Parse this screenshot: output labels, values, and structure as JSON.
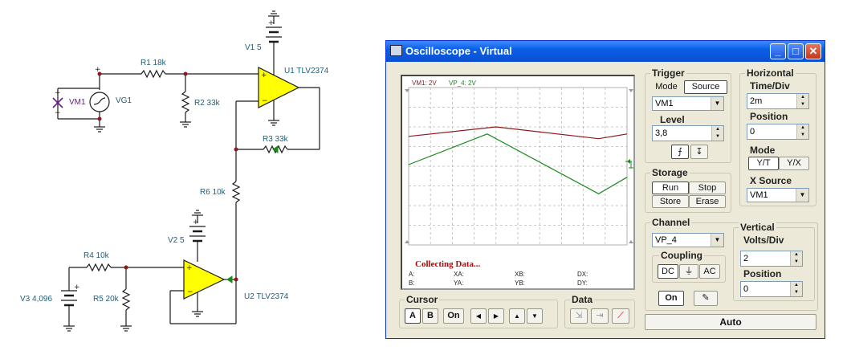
{
  "schematic": {
    "labels": {
      "vm1": "VM1",
      "vg1": "VG1",
      "r1": "R1 18k",
      "r2": "R2 33k",
      "v1": "V1 5",
      "u1": "U1 TLV2374",
      "r3": "R3 33k",
      "r6": "R6 10k",
      "v2": "V2 5",
      "r4": "R4 10k",
      "r5": "R5 20k",
      "v3": "V3 4,096",
      "u2": "U2 TLV2374"
    }
  },
  "window": {
    "title": "Oscilloscope - Virtual",
    "controls": {
      "minimize": "_",
      "maximize": "□",
      "close": "✕"
    }
  },
  "screen": {
    "ch1_label": "VM1: 2V",
    "ch2_label": "VP_4: 2V",
    "ch1_color": "#8b1a1a",
    "ch2_color": "#1a8a1a",
    "collecting": "Collecting Data...",
    "readouts": {
      "a": "A:",
      "xa": "XA:",
      "xb": "XB:",
      "dx": "DX:",
      "b": "B:",
      "ya": "YA:",
      "yb": "YB:",
      "dy": "DY:"
    }
  },
  "chart_data": {
    "type": "line",
    "x": [
      0,
      0.2,
      0.4,
      0.6,
      0.8,
      1.0
    ],
    "series": [
      {
        "name": "VM1",
        "x": [
          0,
          0.4,
          0.87,
          1.0
        ],
        "y": [
          1.9,
          2.5,
          1.75,
          2.05
        ]
      },
      {
        "name": "VP_4",
        "x": [
          0,
          0.36,
          0.87,
          1.0
        ],
        "y": [
          0.1,
          2.05,
          -1.75,
          -0.7
        ]
      }
    ],
    "xlim": [
      0,
      1
    ],
    "ylim": [
      -5,
      5
    ],
    "grid": true
  },
  "trigger": {
    "title": "Trigger",
    "mode": "Mode",
    "source": "Source",
    "source_value": "VM1",
    "level_label": "Level",
    "level_value": "3,8"
  },
  "horizontal": {
    "title": "Horizontal",
    "timediv_label": "Time/Div",
    "timediv_value": "2m",
    "position_label": "Position",
    "position_value": "0",
    "mode_label": "Mode",
    "yt": "Y/T",
    "yx": "Y/X",
    "xsource_label": "X Source",
    "xsource_value": "VM1"
  },
  "storage": {
    "title": "Storage",
    "run": "Run",
    "stop": "Stop",
    "store": "Store",
    "erase": "Erase"
  },
  "channel": {
    "title": "Channel",
    "value": "VP_4",
    "coupling_title": "Coupling",
    "dc": "DC",
    "ac": "AC",
    "on": "On"
  },
  "vertical": {
    "title": "Vertical",
    "voltsdiv_label": "Volts/Div",
    "voltsdiv_value": "2",
    "position_label": "Position",
    "position_value": "0"
  },
  "cursor": {
    "title": "Cursor",
    "a": "A",
    "b": "B",
    "on": "On"
  },
  "data_group": {
    "title": "Data"
  },
  "auto": "Auto"
}
